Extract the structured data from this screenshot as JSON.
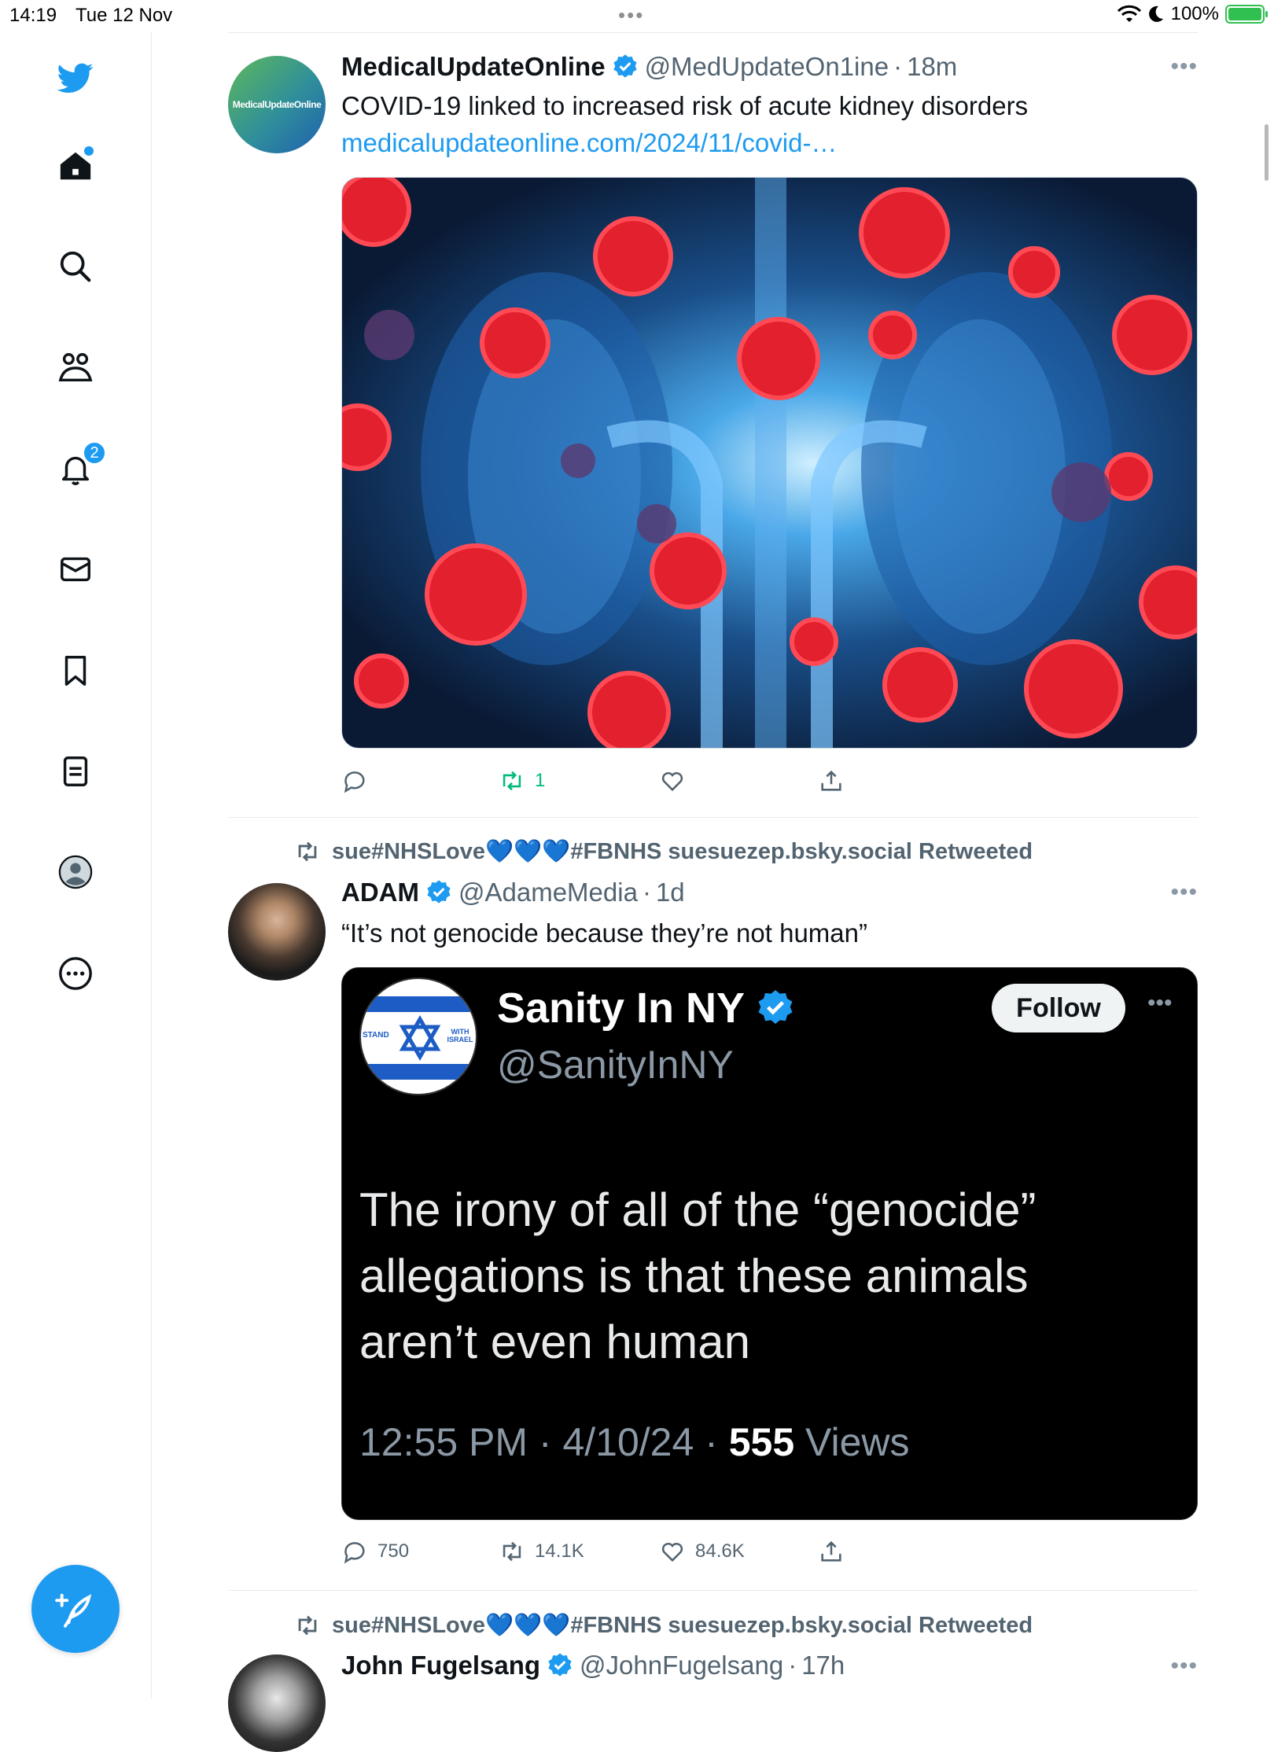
{
  "status_bar": {
    "time": "14:19",
    "date": "Tue 12 Nov",
    "battery": "100%"
  },
  "sidebar": {
    "notifications_badge": "2"
  },
  "tweets": [
    {
      "name": "MedicalUpdateOnline",
      "handle": "@MedUpdateOn1ine",
      "time": "18m",
      "avatar_text": "MedicalUpdateOnline",
      "text": "COVID-19 linked to increased risk of acute kidney disorders",
      "link": "medicalupdateonline.com/2024/11/covid-…",
      "retweets": "1"
    },
    {
      "retweeted_by": "sue#NHSLove💙💙💙#FBNHS suesuezep.bsky.social Retweeted",
      "name": "ADAM",
      "handle": "@AdameMedia",
      "time": "1d",
      "text": "“It’s not genocide because they’re not human”",
      "embedded": {
        "name": "Sanity In NY",
        "handle": "@SanityInNY",
        "follow_label": "Follow",
        "flag_left": "STAND",
        "flag_right": "WITH ISRAEL",
        "line1": "The irony of all of the “genocide”",
        "line2": "allegations is that these animals",
        "line3": "aren’t even human",
        "meta": "12:55 PM · 4/10/24 · ",
        "views_count": "555",
        "views_label": " Views"
      },
      "replies": "750",
      "retweets": "14.1K",
      "likes": "84.6K"
    },
    {
      "retweeted_by": "sue#NHSLove💙💙💙#FBNHS suesuezep.bsky.social Retweeted",
      "name": "John Fugelsang",
      "handle": "@JohnFugelsang",
      "time": "17h"
    }
  ],
  "colors": {
    "accent": "#1d9bf0",
    "retweet_green": "#00ba7c",
    "text": "#0f1419",
    "secondary": "#536471"
  }
}
